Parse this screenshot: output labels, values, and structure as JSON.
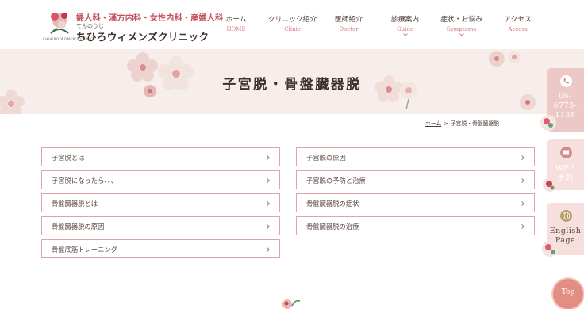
{
  "logo": {
    "tagline": "婦人科・漢方内科・女性内科・産婦人科",
    "sub": "てんのうじ",
    "name": "ちひろウィメンズクリニック",
    "english": "CHIHIRO WOMEN'S CLINIC"
  },
  "nav": [
    {
      "jp": "ホーム",
      "en": "HOME"
    },
    {
      "jp": "クリニック紹介",
      "en": "Clinic"
    },
    {
      "jp": "医師紹介",
      "en": "Doctor"
    },
    {
      "jp": "診療案内",
      "en": "Guide"
    },
    {
      "jp": "症状・お悩み",
      "en": "Symptoms"
    },
    {
      "jp": "アクセス",
      "en": "Access"
    }
  ],
  "hero": {
    "title": "子宮脱・骨盤臓器脱"
  },
  "breadcrumb": {
    "home": "ホーム",
    "separator": ">",
    "current": "子宮脱・骨盤臓器脱"
  },
  "links": {
    "left": [
      "子宮脱とは",
      "子宮脱になったら、、、",
      "骨盤臓器脱とは",
      "骨盤臓器脱の原因",
      "骨盤底筋トレーニング"
    ],
    "right": [
      "子宮脱の原因",
      "子宮脱の予防と治療",
      "骨盤臓器脱の症状",
      "骨盤臓器脱の治療"
    ]
  },
  "side": {
    "phone_lines": [
      "06-",
      "6773-",
      "1138"
    ],
    "web_lines": [
      "WEB",
      "予約"
    ],
    "english_lines": [
      "English",
      "Page"
    ],
    "phone_icon": "phone-icon",
    "web_icon": "web-reservation-icon",
    "english_icon": "globe-icon"
  },
  "top_button": {
    "label": "Top"
  },
  "colors": {
    "accent": "#c44f5c",
    "border": "#dca5a8",
    "hero_bg": "#f7eeec",
    "side_bg": "#ecc8c6",
    "top_bg": "#e48d83"
  }
}
